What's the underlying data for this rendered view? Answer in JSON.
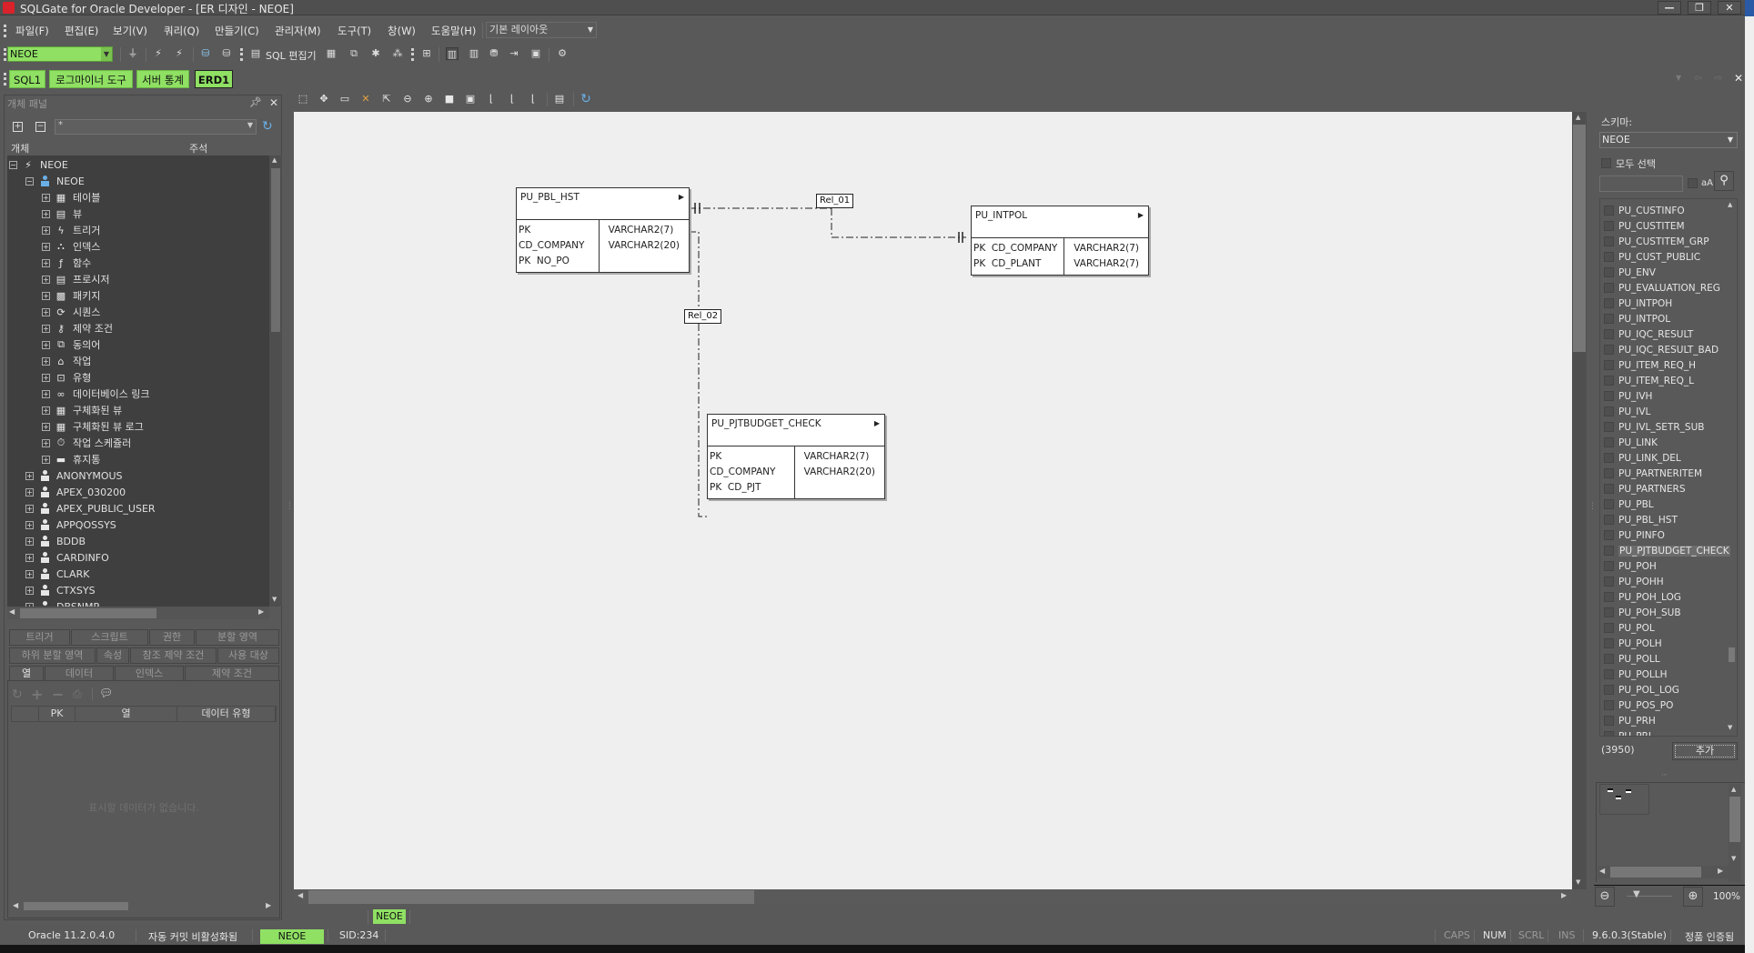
{
  "window": {
    "title": "SQLGate for Oracle Developer - [ER 디자인 - NEOE]",
    "minimize": "—",
    "restore": "❐",
    "close": "✕"
  },
  "menu": {
    "items": [
      "파일(F)",
      "편집(E)",
      "보기(V)",
      "쿼리(Q)",
      "만들기(C)",
      "관리자(M)",
      "도구(T)",
      "창(W)",
      "도움말(H)"
    ],
    "layout_select": "기본 레이아웃"
  },
  "toolbar": {
    "connection": "NEOE",
    "sql_editor_label": "SQL 편집기"
  },
  "doc_tabs": [
    "SQL1",
    "로그마이너 도구",
    "서버 통계",
    "ERD1"
  ],
  "colors": {
    "accent_green": "#8fe063",
    "canvas": "#efefef",
    "app_bg": "#595959",
    "tree_bg": "#3f3f3f"
  },
  "object_panel": {
    "title": "개체 패널",
    "filter": "*",
    "col_object": "개체",
    "col_comment": "주석",
    "root": "NEOE",
    "schema": "NEOE",
    "categories": [
      "테이블",
      "뷰",
      "트리거",
      "인덱스",
      "함수",
      "프로시저",
      "패키지",
      "시퀀스",
      "제약 조건",
      "동의어",
      "작업",
      "유형",
      "데이터베이스 링크",
      "구체화된 뷰",
      "구체화된 뷰 로그",
      "작업 스케쥴러",
      "휴지통"
    ],
    "users": [
      "ANONYMOUS",
      "APEX_030200",
      "APEX_PUBLIC_USER",
      "APPQOSSYS",
      "BDDB",
      "CARDINFO",
      "CLARK",
      "CTXSYS",
      "DBSNMP"
    ]
  },
  "detail_tabs": {
    "row1": [
      "트리거",
      "스크립트",
      "권한",
      "분할 영역"
    ],
    "row2": [
      "하위 분할 영역",
      "속성",
      "참조 제약 조건",
      "사용 대상"
    ],
    "row3": [
      "열",
      "데이터",
      "인덱스",
      "제약 조건"
    ],
    "active": "열",
    "grid_headers": [
      "PK",
      "열",
      "데이터 유형"
    ],
    "empty_message": "표시할 데이터가 없습니다."
  },
  "erd": {
    "entities": [
      {
        "name": "PU_PBL_HST",
        "columns": [
          {
            "key": "PK",
            "name": "CD_COMPANY",
            "type": "VARCHAR2(7)"
          },
          {
            "key": "PK",
            "name": "NO_PO",
            "type": "VARCHAR2(20)"
          }
        ]
      },
      {
        "name": "PU_INTPOL",
        "columns": [
          {
            "key": "PK",
            "name": "CD_COMPANY",
            "type": "VARCHAR2(7)"
          },
          {
            "key": "PK",
            "name": "CD_PLANT",
            "type": "VARCHAR2(7)"
          }
        ]
      },
      {
        "name": "PU_PJTBUDGET_CHECK",
        "columns": [
          {
            "key": "PK",
            "name": "CD_COMPANY",
            "type": "VARCHAR2(7)"
          },
          {
            "key": "PK",
            "name": "CD_PJT",
            "type": "VARCHAR2(20)"
          }
        ]
      }
    ],
    "relations": [
      {
        "label": "Rel_01",
        "from": "PU_PBL_HST",
        "to": "PU_INTPOL"
      },
      {
        "label": "Rel_02",
        "from": "PU_PBL_HST",
        "to": "PU_PJTBUDGET_CHECK"
      }
    ]
  },
  "schema_panel": {
    "label": "스키마:",
    "schema": "NEOE",
    "select_all": "모두 선택",
    "case_label": "aA",
    "count": "(3950)",
    "add_button": "추가",
    "selected": "PU_PJTBUDGET_CHECK",
    "objects": [
      "PU_CUSTINFO",
      "PU_CUSTITEM",
      "PU_CUSTITEM_GRP",
      "PU_CUST_PUBLIC",
      "PU_ENV",
      "PU_EVALUATION_REG",
      "PU_INTPOH",
      "PU_INTPOL",
      "PU_IQC_RESULT",
      "PU_IQC_RESULT_BAD",
      "PU_ITEM_REQ_H",
      "PU_ITEM_REQ_L",
      "PU_IVH",
      "PU_IVL",
      "PU_IVL_SETR_SUB",
      "PU_LINK",
      "PU_LINK_DEL",
      "PU_PARTNERITEM",
      "PU_PARTNERS",
      "PU_PBL",
      "PU_PBL_HST",
      "PU_PINFO",
      "PU_PJTBUDGET_CHECK",
      "PU_POH",
      "PU_POHH",
      "PU_POH_LOG",
      "PU_POH_SUB",
      "PU_POL",
      "PU_POLH",
      "PU_POLL",
      "PU_POLLH",
      "PU_POL_LOG",
      "PU_POS_PO",
      "PU_PRH",
      "PU_PRL"
    ],
    "zoom_level": "100%"
  },
  "session_tag": "NEOE",
  "statusbar": {
    "version_db": "Oracle 11.2.0.4.0",
    "autocommit": "자동 커밋 비활성화됨",
    "connection": "NEOE",
    "sid": "SID:234",
    "caps": "CAPS",
    "num": "NUM",
    "scrl": "SCRL",
    "ins": "INS",
    "app_version": "9.6.0.3(Stable)",
    "license": "정품 인증됨"
  }
}
